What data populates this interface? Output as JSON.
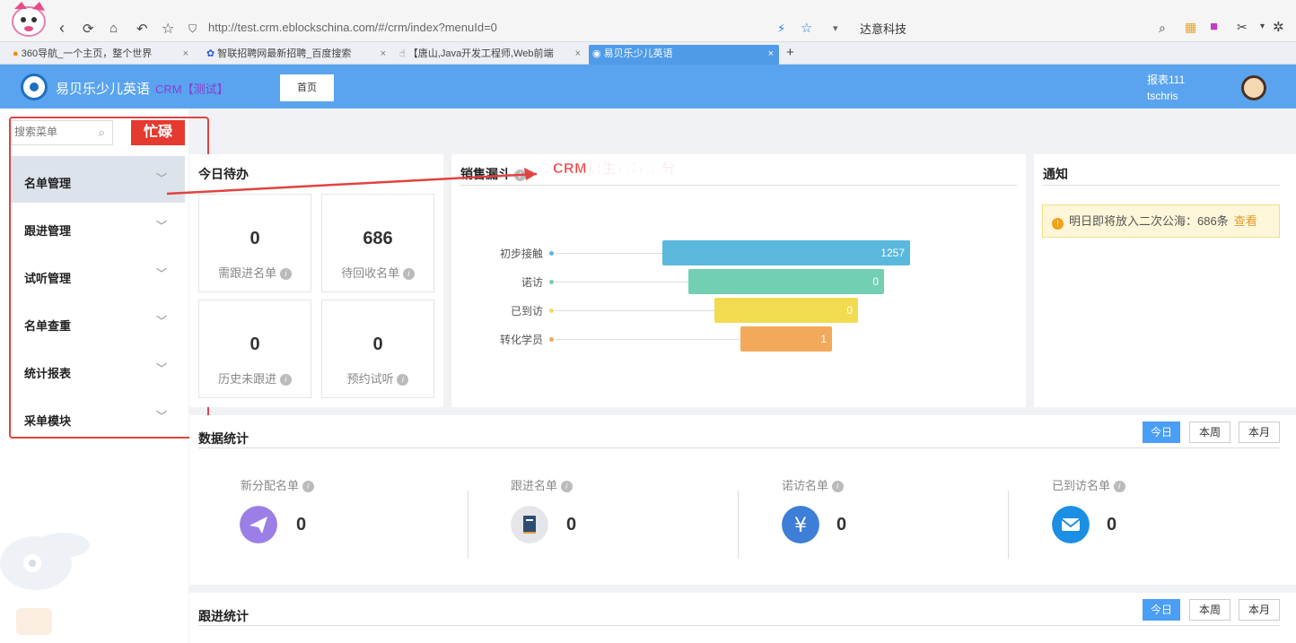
{
  "browser": {
    "url": "http://test.crm.eblockschina.com/#/crm/index?menuId=0",
    "search_engine": "达意科技",
    "tabs": [
      {
        "label": "360导航_一个主页，整个世界",
        "active": false
      },
      {
        "label": "智联招聘网最新招聘_百度搜索",
        "active": false
      },
      {
        "label": "【唐山,Java开发工程师,Web前端",
        "active": false
      },
      {
        "label": "易贝乐少儿英语",
        "active": true
      }
    ],
    "new_tab": "+",
    "close_glyph": "×"
  },
  "header": {
    "brand": "易贝乐少儿英语",
    "crm_tag": "CRM【测试】",
    "home_tab": "首页",
    "user_role": "报表111",
    "user_name": "tschris"
  },
  "sidebar": {
    "search_placeholder": "搜索菜单",
    "busy_button": "忙碌",
    "items": [
      {
        "label": "名单管理"
      },
      {
        "label": "跟进管理"
      },
      {
        "label": "试听管理"
      },
      {
        "label": "名单查重"
      },
      {
        "label": "统计报表"
      },
      {
        "label": "采单模块"
      }
    ]
  },
  "todo": {
    "title": "今日待办",
    "items": [
      {
        "value": "0",
        "label": "需跟进名单"
      },
      {
        "value": "686",
        "label": "待回收名单"
      },
      {
        "value": "0",
        "label": "历史未跟进"
      },
      {
        "value": "0",
        "label": "预约试听"
      }
    ]
  },
  "funnel": {
    "title": "销售漏斗",
    "annotation": "CRM招生管理部分"
  },
  "chart_data": {
    "type": "bar",
    "title": "销售漏斗",
    "categories": [
      "初步接触",
      "诺访",
      "已到访",
      "转化学员"
    ],
    "values": [
      1257,
      0,
      0,
      1
    ],
    "colors": [
      "#5ab8dc",
      "#72cfb3",
      "#f1dc50",
      "#f2a95a"
    ]
  },
  "notice": {
    "title": "通知",
    "text": "明日即将放入二次公海：686条",
    "link": "查看"
  },
  "data_stats": {
    "title": "数据统计",
    "periods": [
      "今日",
      "本周",
      "本月"
    ],
    "items": [
      {
        "label": "新分配名单",
        "value": "0",
        "icon": "paper-plane-icon",
        "color": "#9b7fe6"
      },
      {
        "label": "跟进名单",
        "value": "0",
        "icon": "book-icon",
        "color": "#e4e6ea"
      },
      {
        "label": "诺访名单",
        "value": "0",
        "icon": "yuan-icon",
        "color": "#3d7ed6"
      },
      {
        "label": "已到访名单",
        "value": "0",
        "icon": "mail-icon",
        "color": "#1a8fe3"
      }
    ]
  },
  "follow_stats": {
    "title": "跟进统计",
    "periods": [
      "今日",
      "本周",
      "本月"
    ]
  }
}
